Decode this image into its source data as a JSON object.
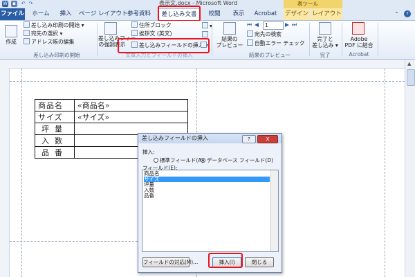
{
  "window": {
    "title": "表示文.docx - Microsoft Word",
    "contextual_group": "表ツール"
  },
  "tabs": [
    {
      "label": "ファイル"
    },
    {
      "label": "ホーム"
    },
    {
      "label": "挿入"
    },
    {
      "label": "ページ レイアウト"
    },
    {
      "label": "参考資料"
    },
    {
      "label": "差し込み文書"
    },
    {
      "label": "校閲"
    },
    {
      "label": "表示"
    },
    {
      "label": "Acrobat"
    },
    {
      "label": "デザイン"
    },
    {
      "label": "レイアウト"
    }
  ],
  "ribbon": {
    "create": "作成",
    "start_merge": "差し込み印刷の開始",
    "select_recipients": "宛先の選択",
    "edit_address_book": "アドレス帳の編集",
    "group_start": "差し込み印刷の開始",
    "highlight_fields_l1": "差し込みフィー",
    "highlight_fields_l2": "の強調表示",
    "address_block": "住所ブロック",
    "greeting_line": "挨拶文 (英文)",
    "insert_merge_field": "差し込みフィールドの挿入",
    "group_write": "文章入力とフィールドの挿入",
    "preview_l1": "結果の",
    "preview_l2": "プレビュー",
    "record_number": "1",
    "find_recipient": "宛先の検索",
    "auto_check": "自動エラー チェック",
    "group_preview": "結果のプレビュー",
    "finish_l1": "完了と",
    "finish_l2": "差し込み",
    "group_finish": "完了",
    "adobe_l1": "Adobe",
    "adobe_l2": "PDF に結合",
    "group_acrobat": "Acrobat"
  },
  "document": {
    "rows": [
      {
        "label": "商品名",
        "value": "«商品名»"
      },
      {
        "label": "サイズ",
        "value": "«サイズ»"
      },
      {
        "label": "坪量",
        "value": ""
      },
      {
        "label": "入数",
        "value": ""
      },
      {
        "label": "品番",
        "value": ""
      }
    ]
  },
  "dialog": {
    "title": "差し込みフィールドの挿入",
    "help": "?",
    "close": "X",
    "insert_label": "挿入:",
    "radio_standard": "標準フィールド(A)",
    "radio_database": "データベース フィールド(D)",
    "fields_label": "フィールド(E):",
    "fields": [
      "商品名",
      "サイズ",
      "坪量",
      "入数",
      "品番"
    ],
    "selected_index": 1,
    "btn_match": "フィールドの対応(M)...",
    "btn_insert": "挿入(I)",
    "btn_close": "閉じる"
  },
  "colors": {
    "highlight": "#e8131e",
    "file_tab": "#2a5ea6",
    "selection": "#3399ff"
  }
}
